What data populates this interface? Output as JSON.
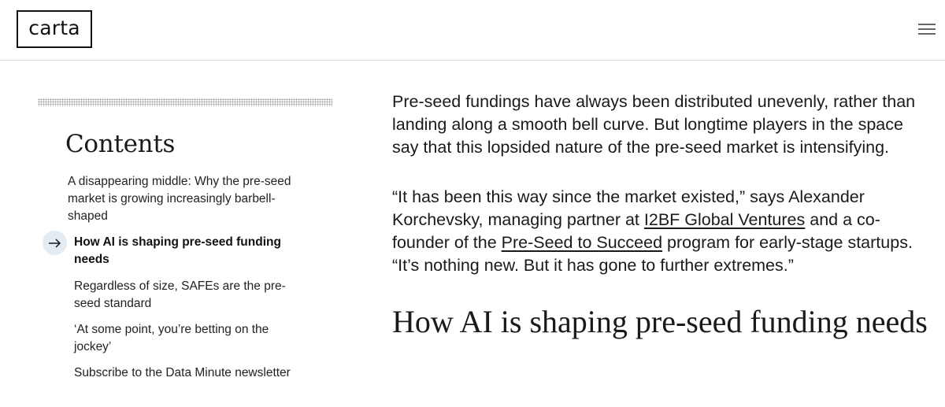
{
  "header": {
    "logo_text": "carta",
    "menu_icon": "hamburger-menu-icon"
  },
  "toc": {
    "title": "Contents",
    "active_icon": "arrow-right-icon",
    "items": [
      {
        "label": "A disappearing middle: Why the pre-seed market is growing increasingly barbell-shaped",
        "active": false
      },
      {
        "label": "How AI is shaping pre-seed funding needs",
        "active": true
      },
      {
        "label": "Regardless of size, SAFEs are the pre-seed standard",
        "active": false
      },
      {
        "label": "‘At some point, you’re betting on the jockey’",
        "active": false
      },
      {
        "label": "Subscribe to the Data Minute newsletter",
        "active": false
      }
    ]
  },
  "article": {
    "p1": "Pre-seed fundings have always been distributed unevenly, rather than landing along a smooth bell curve. But longtime players in the space say that this lopsided nature of the pre-seed market is intensifying.",
    "p2_part1": "“It has been this way since the market existed,” says Alexander Korchevsky, managing partner at ",
    "p2_link1": "I2BF Global Ventures",
    "p2_part2": " and a co-founder of the ",
    "p2_link2": "Pre-Seed to Succeed",
    "p2_part3": " program for early-stage startups. “It’s nothing new. But it has gone to further extremes.”",
    "heading": "How AI is shaping pre-seed funding needs"
  }
}
